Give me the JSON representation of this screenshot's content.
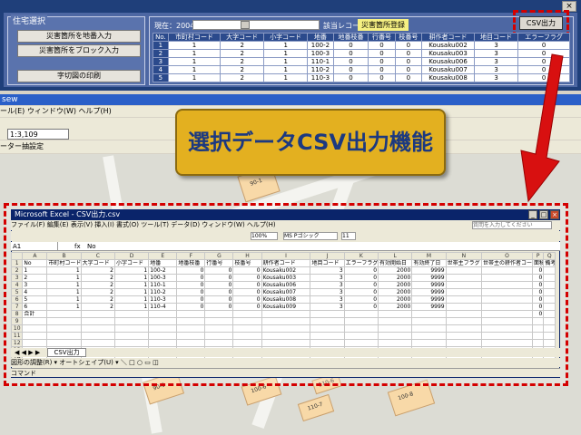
{
  "top_app": {
    "close_label": "×",
    "group_title": "住宅選択",
    "buttons": [
      "災害箇所を地番入力",
      "災害箇所をブロック入力",
      "字切図の印刷"
    ],
    "year_label": "現在：2004 年",
    "count_label": "該当レコード【 6 】件",
    "register_button": "災害箇所登録",
    "csv_button": "CSV出力",
    "table": {
      "headers": [
        "No.",
        "市町村コード",
        "大字コード",
        "小字コード",
        "地番",
        "地番枝番",
        "行番号",
        "枝番号",
        "耕作者コード",
        "地目コード",
        "エラーフラグ"
      ],
      "rows": [
        [
          "1",
          "1",
          "2",
          "1",
          "100-2",
          "0",
          "0",
          "0",
          "Kousaku002",
          "3",
          "0"
        ],
        [
          "2",
          "1",
          "2",
          "1",
          "100-3",
          "0",
          "0",
          "0",
          "Kousaku003",
          "3",
          "0"
        ],
        [
          "3",
          "1",
          "2",
          "1",
          "110-1",
          "0",
          "0",
          "0",
          "Kousaku006",
          "3",
          "0"
        ],
        [
          "4",
          "1",
          "2",
          "1",
          "110-2",
          "0",
          "0",
          "0",
          "Kousaku007",
          "3",
          "0"
        ],
        [
          "5",
          "1",
          "2",
          "1",
          "110-3",
          "0",
          "0",
          "0",
          "Kousaku008",
          "3",
          "0"
        ]
      ]
    }
  },
  "gis": {
    "title": "sew",
    "menu": "ール(E)  ウィンドウ(W)  ヘルプ(H)",
    "scale": "1:3,109",
    "toolbar2": "ーター抽設定",
    "parcels": [
      "90-1",
      "100-6",
      "110-6",
      "110-7",
      "90-9",
      "100-8"
    ]
  },
  "callout": "選択データCSV出力機能",
  "excel": {
    "title": "Microsoft Excel - CSV出力.csv",
    "menu": "ファイル(F)  編集(E)  表示(V)  挿入(I)  書式(O)  ツール(T)  データ(D)  ウィンドウ(W)  ヘルプ(H)",
    "help_box": "質問を入力してください",
    "font": "MS Pゴシック",
    "font_size": "11",
    "zoom": "100%",
    "cell_ref": "A1",
    "formula": "No",
    "col_letters": [
      "",
      "A",
      "B",
      "C",
      "D",
      "E",
      "F",
      "G",
      "H",
      "I",
      "J",
      "K",
      "L",
      "M",
      "N",
      "O",
      "P",
      "Q"
    ],
    "header_row": [
      "No",
      "市町村コード",
      "大字コード",
      "小字コード",
      "地番",
      "地番枝番",
      "行番号",
      "枝番号",
      "耕作者コード",
      "地目コード",
      "エラーフラグ",
      "有効開始日",
      "有効終了日",
      "世帯主フラグ",
      "世帯主の耕作者コード",
      "面積",
      "備考"
    ],
    "rows": [
      [
        "1",
        "1",
        "2",
        "1",
        "100-2",
        "0",
        "0",
        "0",
        "Kousaku002",
        "3",
        "0",
        "2000",
        "9999",
        "",
        "",
        "0",
        ""
      ],
      [
        "2",
        "1",
        "2",
        "1",
        "100-3",
        "0",
        "0",
        "0",
        "Kousaku003",
        "3",
        "0",
        "2000",
        "9999",
        "",
        "",
        "0",
        ""
      ],
      [
        "3",
        "1",
        "2",
        "1",
        "110-1",
        "0",
        "0",
        "0",
        "Kousaku006",
        "3",
        "0",
        "2000",
        "9999",
        "",
        "",
        "0",
        ""
      ],
      [
        "4",
        "1",
        "2",
        "1",
        "110-2",
        "0",
        "0",
        "0",
        "Kousaku007",
        "3",
        "0",
        "2000",
        "9999",
        "",
        "",
        "0",
        ""
      ],
      [
        "5",
        "1",
        "2",
        "1",
        "110-3",
        "0",
        "0",
        "0",
        "Kousaku008",
        "3",
        "0",
        "2000",
        "9999",
        "",
        "",
        "0",
        ""
      ],
      [
        "6",
        "1",
        "2",
        "1",
        "110-4",
        "0",
        "0",
        "0",
        "Kousaku009",
        "3",
        "0",
        "2000",
        "9999",
        "",
        "",
        "0",
        ""
      ],
      [
        "合計",
        "",
        "",
        "",
        "",
        "",
        "",
        "",
        "",
        "",
        "",
        "",
        "",
        "",
        "",
        "0",
        ""
      ]
    ],
    "sheet_tab": "CSV出力",
    "drawbar": "図形の調整(R) ▾  オートシェイプ(U) ▾  ＼ □ ○ ▭ ◫",
    "status": "コマンド"
  }
}
